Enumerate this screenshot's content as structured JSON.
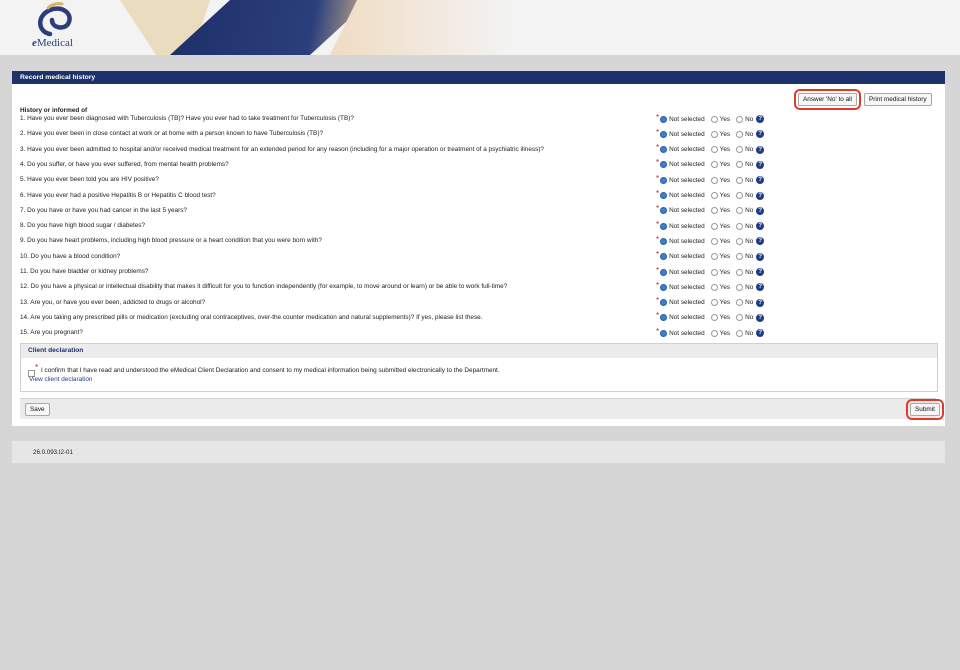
{
  "header": {
    "logo_text_e": "e",
    "logo_text_rest": "Medical"
  },
  "panel": {
    "title": "Record medical history",
    "answer_no_label": "Answer 'No' to all",
    "print_label": "Print medical history"
  },
  "history": {
    "heading": "History or informed of",
    "option_labels": [
      "Not selected",
      "Yes",
      "No"
    ],
    "help_glyph": "?",
    "questions": [
      "1.  Have you ever been diagnosed with Tuberculosis (TB)? Have you ever had to take treatment for Tuberculosis (TB)?",
      "2.  Have you ever been in close contact at work or at home with a person known to have Tuberculosis (TB)?",
      "3.  Have you ever been admitted to hospital and/or received medical treatment for an extended period for any reason (including for a major operation or treatment of a psychiatric illness)?",
      "4.  Do you suffer, or have you ever suffered, from mental health problems?",
      "5.  Have you ever been told you are HIV positive?",
      "6.  Have you ever had a positive Hepatitis B or Hepatitis C blood test?",
      "7.  Do you have or have you had cancer in the last 5 years?",
      "8.  Do you have high blood sugar / diabetes?",
      "9.  Do you have heart problems, including high blood pressure or a heart condition that you were born with?",
      "10.  Do you have a blood condition?",
      "11.  Do you have bladder or kidney problems?",
      "12.  Do you have a physical or intellectual disability that makes it difficult for you to function independently (for example, to move around or learn) or be able to work full-time?",
      "13.  Are you, or have you ever been, addicted to drugs or alcohol?",
      "14.  Are you taking any prescribed pills or medication (excluding oral contraceptives, over-the counter medication and natural supplements)? If yes, please list these.",
      "15.  Are you pregnant?"
    ],
    "selected": "Not selected"
  },
  "declaration": {
    "title": "Client declaration",
    "text": "I confirm that I have read and understood the eMedical Client Declaration and consent to my medical information being submitted electronically to the Department.",
    "link": "View client declaration"
  },
  "actions": {
    "save_label": "Save",
    "submit_label": "Submit"
  },
  "footer": {
    "version": "26.0.093.I2-01"
  },
  "colors": {
    "header_bar": "#1d326b",
    "highlight": "#e13a28",
    "page_bg": "#d6d6d6"
  }
}
